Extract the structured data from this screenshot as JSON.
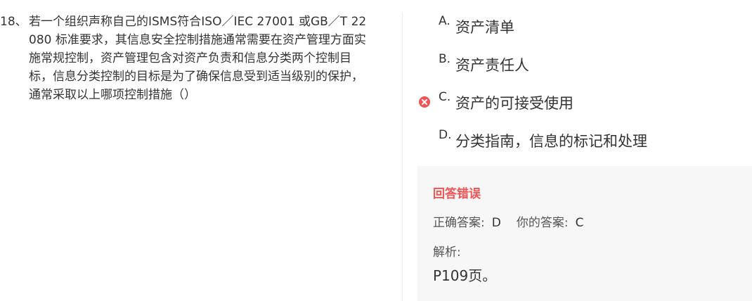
{
  "question": {
    "number": "18、",
    "text": "若一个组织声称自己的ISMS符合ISO／IEC 27001 或GB／T 22080 标准要求，其信息安全控制措施通常需要在资产管理方面实施常规控制，资产管理包含对资产负责和信息分类两个控制目标，信息分类控制的目标是为了确保信息受到适当级别的保护，通常采取以上哪项控制措施（）"
  },
  "options": [
    {
      "letter": "A.",
      "text": "资产清单"
    },
    {
      "letter": "B.",
      "text": "资产责任人"
    },
    {
      "letter": "C.",
      "text": "资产的可接受使用",
      "status": "wrong"
    },
    {
      "letter": "D.",
      "text": "分类指南，信息的标记和处理"
    }
  ],
  "icons": {
    "wrong_mark": "x-circle-icon"
  },
  "colors": {
    "error": "#f05454",
    "panel": "#f7f7f7"
  },
  "result": {
    "title": "回答错误",
    "correct_label": "正确答案:",
    "correct_value": "D",
    "yours_label": "你的答案:",
    "yours_value": "C",
    "analysis_label": "解析:",
    "analysis_text": "P109页。"
  }
}
